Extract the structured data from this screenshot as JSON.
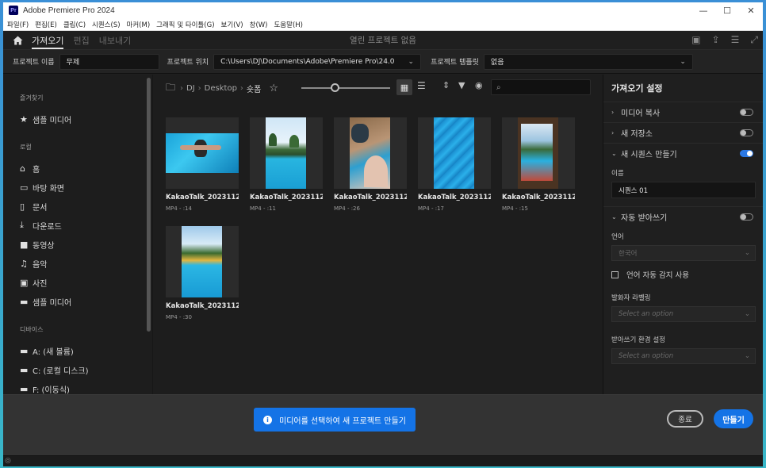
{
  "window": {
    "app_icon": "Pr",
    "title": "Adobe Premiere Pro 2024",
    "controls": {
      "minimize": "—",
      "maximize": "☐",
      "close": "✕"
    }
  },
  "menu": [
    "파일(F)",
    "편집(E)",
    "클립(C)",
    "시퀀스(S)",
    "마커(M)",
    "그래픽 및 타이틀(G)",
    "보기(V)",
    "창(W)",
    "도움말(H)"
  ],
  "workspace": {
    "tabs": [
      {
        "label": "가져오기",
        "active": true
      },
      {
        "label": "편집",
        "active": false
      },
      {
        "label": "내보내기",
        "active": false
      }
    ],
    "center_label": "열린 프로젝트 없음"
  },
  "project": {
    "name_label": "프로젝트 이름",
    "name_value": "무제",
    "location_label": "프로젝트 위치",
    "location_value": "C:\\Users\\DJ\\Documents\\Adobe\\Premiere Pro\\24.0",
    "template_label": "프로젝트 템플릿",
    "template_value": "없음"
  },
  "sidebar": {
    "favorites_header": "즐겨찾기",
    "favorites": [
      {
        "label": "샘플 미디어",
        "icon": "star-icon"
      }
    ],
    "local_header": "로컬",
    "local": [
      {
        "label": "홈",
        "icon": "home-icon"
      },
      {
        "label": "바탕 화면",
        "icon": "desktop-icon"
      },
      {
        "label": "문서",
        "icon": "document-icon"
      },
      {
        "label": "다운로드",
        "icon": "download-icon"
      },
      {
        "label": "동영상",
        "icon": "video-icon"
      },
      {
        "label": "음악",
        "icon": "music-icon"
      },
      {
        "label": "사진",
        "icon": "photo-icon"
      },
      {
        "label": "샘플 미디어",
        "icon": "folder-icon"
      }
    ],
    "devices_header": "디바이스",
    "devices": [
      {
        "label": "A: (새 볼륨)",
        "icon": "folder-icon"
      },
      {
        "label": "C: (로컬 디스크)",
        "icon": "folder-icon"
      },
      {
        "label": "F: (이동식)",
        "icon": "folder-icon"
      }
    ]
  },
  "browser": {
    "breadcrumb": [
      "DJ",
      "Desktop",
      "숏폼"
    ],
    "zoom_level": 0.38,
    "search_placeholder": "",
    "files": [
      {
        "name": "KakaoTalk_2023112...",
        "meta": "MP4 - :14",
        "scene": "wide"
      },
      {
        "name": "KakaoTalk_2023112...",
        "meta": "MP4 - :11",
        "scene": "palms"
      },
      {
        "name": "KakaoTalk_2023112...",
        "meta": "MP4 - :26",
        "scene": "closeup"
      },
      {
        "name": "KakaoTalk_2023112...",
        "meta": "MP4 - :17",
        "scene": "water"
      },
      {
        "name": "KakaoTalk_2023112...",
        "meta": "MP4 - :15",
        "scene": "window"
      },
      {
        "name": "KakaoTalk_2023112...",
        "meta": "MP4 - :30",
        "scene": "palms2"
      }
    ]
  },
  "settings": {
    "title": "가져오기 설정",
    "copy_media": "미디어 복사",
    "new_bin": "새 저장소",
    "create_sequence": "새 시퀀스 만들기",
    "name_label": "이름",
    "sequence_name": "시퀀스 01",
    "auto_transcribe": "자동 받아쓰기",
    "language_label": "언어",
    "language_value": "한국어",
    "auto_detect_language": "언어 자동 감지 사용",
    "speaker_label": "발화자 라벨링",
    "speaker_placeholder": "Select an option",
    "transcribe_pref_label": "받아쓰기 환경 설정",
    "transcribe_pref_placeholder": "Select an option",
    "accent_color": "#2b78e4"
  },
  "footer": {
    "info_message": "미디어를 선택하여 새 프로젝트 만들기",
    "close_label": "종료",
    "create_label": "만들기",
    "accent_color": "#1473e6"
  }
}
